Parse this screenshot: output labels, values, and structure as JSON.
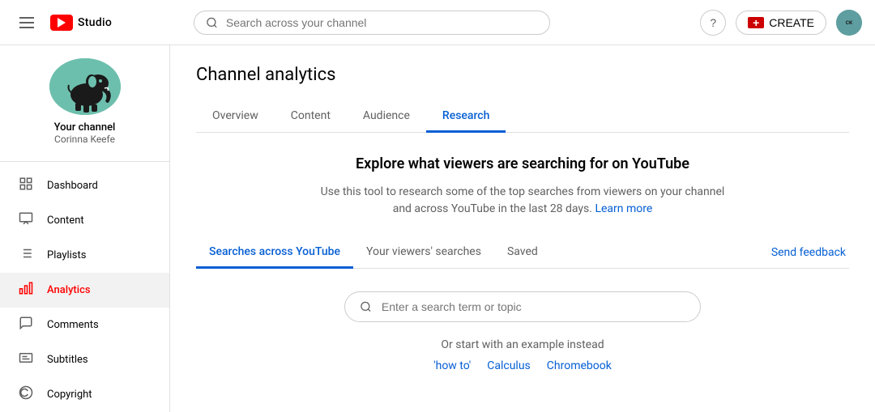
{
  "nav": {
    "hamburger_label": "Menu",
    "logo_text": "Studio",
    "search_placeholder": "Search across your channel",
    "help_label": "?",
    "create_label": "CREATE",
    "avatar_initials": "CK"
  },
  "sidebar": {
    "channel_name": "Your channel",
    "channel_subname": "Corinna Keefe",
    "items": [
      {
        "id": "dashboard",
        "label": "Dashboard",
        "icon": "⊞"
      },
      {
        "id": "content",
        "label": "Content",
        "icon": "▦"
      },
      {
        "id": "playlists",
        "label": "Playlists",
        "icon": "☰"
      },
      {
        "id": "analytics",
        "label": "Analytics",
        "icon": "📊",
        "active": true
      },
      {
        "id": "comments",
        "label": "Comments",
        "icon": "🗨"
      },
      {
        "id": "subtitles",
        "label": "Subtitles",
        "icon": "⬜"
      },
      {
        "id": "copyright",
        "label": "Copyright",
        "icon": "©"
      }
    ]
  },
  "main": {
    "page_title": "Channel analytics",
    "tabs": [
      {
        "id": "overview",
        "label": "Overview",
        "active": false
      },
      {
        "id": "content",
        "label": "Content",
        "active": false
      },
      {
        "id": "audience",
        "label": "Audience",
        "active": false
      },
      {
        "id": "research",
        "label": "Research",
        "active": true
      }
    ],
    "research": {
      "title": "Explore what viewers are searching for on YouTube",
      "description": "Use this tool to research some of the top searches from viewers on your channel and across YouTube in the last 28 days.",
      "learn_more": "Learn more",
      "sub_tabs": [
        {
          "id": "searches-across-youtube",
          "label": "Searches across YouTube",
          "active": true
        },
        {
          "id": "your-viewers-searches",
          "label": "Your viewers' searches",
          "active": false
        },
        {
          "id": "saved",
          "label": "Saved",
          "active": false
        }
      ],
      "send_feedback": "Send feedback",
      "search_placeholder": "Enter a search term or topic",
      "example_prefix": "Or start with",
      "example_middle": "an example instead",
      "example_links": [
        {
          "label": "'how to'"
        },
        {
          "label": "Calculus"
        },
        {
          "label": "Chromebook"
        }
      ]
    }
  }
}
